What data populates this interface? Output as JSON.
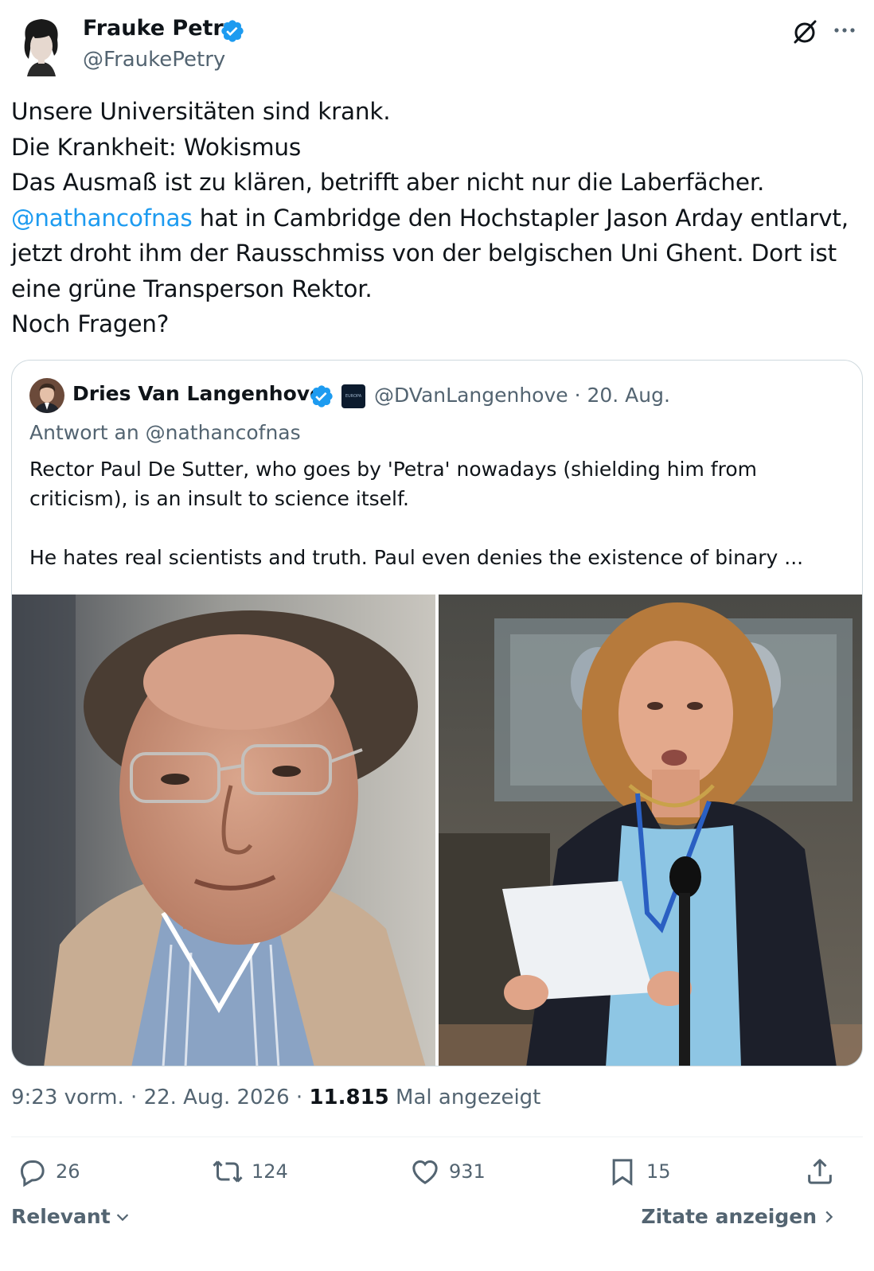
{
  "author": {
    "name": "Frauke Petry",
    "handle": "@FraukePetry"
  },
  "tweet": {
    "line1": "Unsere Universitäten sind krank.",
    "line2": "Die Krankheit: Wokismus",
    "line3": "Das Ausmaß ist zu klären, betrifft aber nicht nur die Laberfächer.",
    "mention": "@nathancofnas",
    "line4_rest": " hat in Cambridge den Hochstapler Jason Arday entlarvt,",
    "line5": "jetzt droht ihm der Rausschmiss von der belgischen Uni Ghent. Dort ist",
    "line6": "eine grüne Transperson Rektor.",
    "line7": "Noch Fragen?"
  },
  "quote": {
    "name": "Dries Van Langenhove",
    "affiliate_label": "EUROPA",
    "meta": "@DVanLangenhove · 20. Aug.",
    "reply_to": "Antwort an @nathancofnas",
    "text_line1": "Rector Paul De Sutter, who goes by 'Petra' nowadays (shielding him from",
    "text_line2": "criticism), is an insult to science itself.",
    "text_line3": "He hates real scientists and truth. Paul even denies the existence of binary ..."
  },
  "meta": {
    "time_date": "9:23 vorm. · 22. Aug. 2026 · ",
    "views_count": "11.815",
    "views_label": " Mal angezeigt"
  },
  "actions": {
    "replies": "26",
    "reposts": "124",
    "likes": "931",
    "bookmarks": "15"
  },
  "footer": {
    "sort_label": "Relevant",
    "quotes_label": "Zitate anzeigen"
  },
  "colors": {
    "accent": "#1d9bf0",
    "muted": "#536471",
    "text": "#0f1419",
    "border": "#cfd9de"
  },
  "icons": [
    "verified-badge-icon",
    "grok-icon",
    "more-icon",
    "reply-icon",
    "repost-icon",
    "like-icon",
    "bookmark-icon",
    "share-icon",
    "chevron-down-icon",
    "chevron-right-icon"
  ]
}
